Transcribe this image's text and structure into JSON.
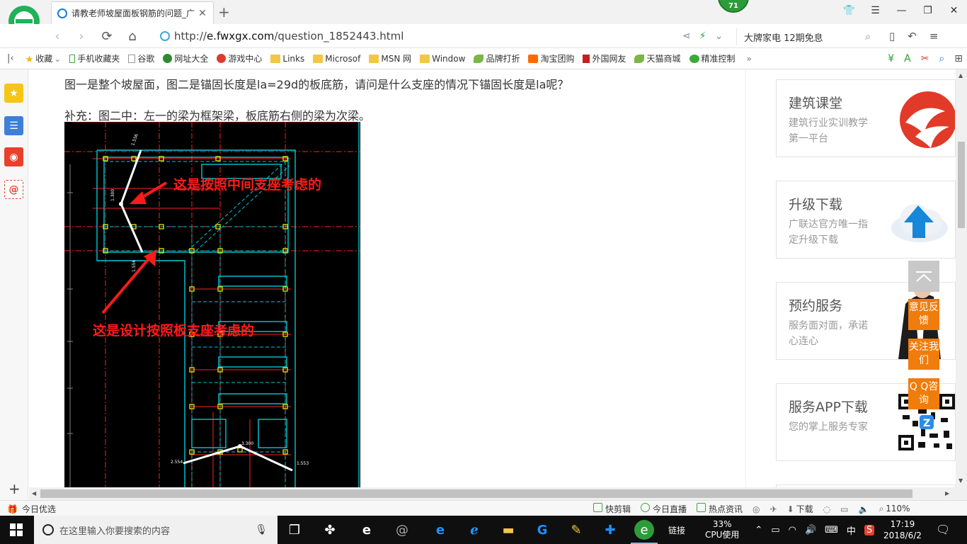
{
  "browser": {
    "tab_title": "请教老师坡屋面板钢筋的问题_广",
    "badge_count": "71",
    "url_prefix": "http://",
    "url_host": "e.fwxgx.com",
    "url_path": "/question_1852443.html",
    "search_text": "大牌家电 12期免息"
  },
  "bookmarks": [
    {
      "label": "收藏",
      "icon": "star-icon",
      "color": "#f2b600"
    },
    {
      "label": "手机收藏夹",
      "icon": "phone-icon",
      "color": "#3aa83a"
    },
    {
      "label": "谷歌",
      "icon": "page-icon",
      "color": "#999999"
    },
    {
      "label": "网址大全",
      "icon": "globe-icon",
      "color": "#2f8a2f"
    },
    {
      "label": "游戏中心",
      "icon": "game-icon",
      "color": "#e03a2f"
    },
    {
      "label": "Links",
      "icon": "folder-icon",
      "color": "#f2c744"
    },
    {
      "label": "Microsof",
      "icon": "folder-icon",
      "color": "#f2c744"
    },
    {
      "label": "MSN 网",
      "icon": "folder-icon",
      "color": "#f2c744"
    },
    {
      "label": "Window",
      "icon": "folder-icon",
      "color": "#f2c744"
    },
    {
      "label": "品牌打折",
      "icon": "leaf-icon",
      "color": "#7ab648"
    },
    {
      "label": "淘宝团购",
      "icon": "taobao-icon",
      "color": "#ff6a00"
    },
    {
      "label": "外国网友",
      "icon": "bookmark-icon",
      "color": "#c81e1e"
    },
    {
      "label": "天猫商城",
      "icon": "leaf-icon",
      "color": "#7ab648"
    },
    {
      "label": "精准控制",
      "icon": "chat-icon",
      "color": "#3aa83a"
    }
  ],
  "question": {
    "line1": "图一是整个坡屋面，图二是锚固长度是la=29d的板底筋，请问是什么支座的情况下锚固长度是la呢？",
    "line2": "补充：图二中：左一的梁为框架梁，板底筋右侧的梁为次梁。",
    "annotation_top": "这是按照中间支座考虑的",
    "annotation_bottom": "这是设计按照板支座考虑的",
    "cad_labels": {
      "t1": "1.556",
      "t2": "1.300",
      "t3": "1.556",
      "b1": "2.554",
      "b2": "3.300",
      "b3": "1.553"
    }
  },
  "sidebar_cards": [
    {
      "title": "建筑课堂",
      "sub": "建筑行业实训教学第一平台",
      "icon": "logo-swirl-icon"
    },
    {
      "title": "升级下载",
      "sub": "广联达官方唯一指定升级下载",
      "icon": "cloud-upload-icon"
    },
    {
      "title": "预约服务",
      "sub": "服务面对面，承诺心连心",
      "icon": "person-photo-icon"
    },
    {
      "title": "服务APP下载",
      "sub": "您的掌上服务专家",
      "icon": "qr-code-icon"
    }
  ],
  "float_buttons": [
    {
      "label": "意见反馈"
    },
    {
      "label": "关注我们"
    },
    {
      "label": "Q Q咨询"
    }
  ],
  "statusbar": {
    "left": "今日优选",
    "items": [
      "快剪辑",
      "今日直播",
      "热点资讯"
    ],
    "download": "下载",
    "zoom": "110%"
  },
  "taskbar": {
    "search_placeholder": "在这里输入你要搜索的内容",
    "links_label": "链接",
    "cpu_percent": "33%",
    "cpu_label": "CPU使用",
    "ime": "中",
    "time": "17:19",
    "date": "2018/6/2"
  },
  "colors": {
    "accent_green": "#2e9b3a",
    "float_orange": "#f07c0b",
    "cad_red": "#ff0000",
    "cad_cyan": "#00c8d2"
  }
}
